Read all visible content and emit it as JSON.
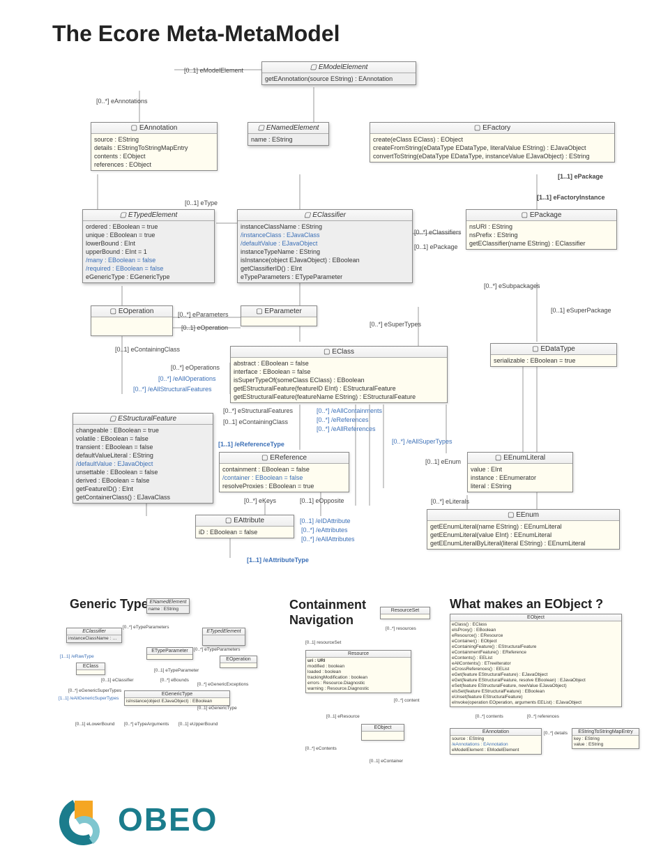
{
  "title": "The Ecore Meta-MetaModel",
  "sections": {
    "generic": "Generic Types",
    "containment": "Containment Navigation",
    "eobject": "What makes an EObject ?"
  },
  "classes": {
    "EModelElement": {
      "abstract": true,
      "ops": [
        "getEAnnotation(source EString) : EAnnotation"
      ]
    },
    "EAnnotation": {
      "attrs": [
        "source : EString",
        "details : EStringToStringMapEntry",
        "contents : EObject",
        "references : EObject"
      ]
    },
    "ENamedElement": {
      "abstract": true,
      "attrs": [
        "name : EString"
      ]
    },
    "EFactory": {
      "ops": [
        "create(eClass EClass) : EObject",
        "createFromString(eDataType EDataType, literalValue EString) : EJavaObject",
        "convertToString(eDataType EDataType, instanceValue EJavaObject) : EString"
      ]
    },
    "ETypedElement": {
      "abstract": true,
      "attrs": [
        "ordered : EBoolean = true",
        "unique : EBoolean = true",
        "lowerBound : EInt",
        "upperBound : EInt = 1"
      ],
      "derived": [
        "/many : EBoolean = false",
        "/required : EBoolean = false"
      ],
      "tail": [
        "eGenericType : EGenericType"
      ]
    },
    "EClassifier": {
      "abstract": true,
      "attrs": [
        "instanceClassName : EString"
      ],
      "derived": [
        "/instanceClass : EJavaClass",
        "/defaultValue : EJavaObject"
      ],
      "mid": [
        "instanceTypeName : EString"
      ],
      "ops": [
        "isInstance(object EJavaObject) : EBoolean",
        "getClassifierID() : EInt"
      ],
      "tail": [
        "eTypeParameters : ETypeParameter"
      ]
    },
    "EPackage": {
      "attrs": [
        "nsURI : EString",
        "nsPrefix : EString"
      ],
      "ops": [
        "getEClassifier(name EString) : EClassifier"
      ]
    },
    "EOperation": {},
    "EParameter": {},
    "EClass": {
      "attrs": [
        "abstract : EBoolean = false",
        "interface : EBoolean = false"
      ],
      "ops": [
        "isSuperTypeOf(someClass EClass) : EBoolean",
        "getEStructuralFeature(featureID EInt) : EStructuralFeature",
        "getEStructuralFeature(featureName EString) : EStructuralFeature"
      ]
    },
    "EDataType": {
      "attrs": [
        "serializable : EBoolean = true"
      ]
    },
    "EStructuralFeature": {
      "abstract": true,
      "attrs": [
        "changeable : EBoolean = true",
        "volatile : EBoolean = false",
        "transient : EBoolean = false",
        "defaultValueLiteral : EString"
      ],
      "derived": [
        "/defaultValue : EJavaObject"
      ],
      "mid": [
        "unsettable : EBoolean = false",
        "derived : EBoolean = false"
      ],
      "ops": [
        "getFeatureID() : EInt",
        "getContainerClass() : EJavaClass"
      ]
    },
    "EReference": {
      "attrs": [
        "containment : EBoolean = false"
      ],
      "derived": [
        "/container : EBoolean = false"
      ],
      "mid": [
        "resolveProxies : EBoolean = true"
      ]
    },
    "EAttribute": {
      "attrs": [
        "iD : EBoolean = false"
      ]
    },
    "EEnumLiteral": {
      "attrs": [
        "value : EInt",
        "instance : EEnumerator",
        "literal : EString"
      ]
    },
    "EEnum": {
      "ops": [
        "getEEnumLiteral(name EString) : EEnumLiteral",
        "getEEnumLiteral(value EInt) : EEnumLiteral",
        "getEEnumLiteralByLiteral(literal EString) : EEnumLiteral"
      ]
    }
  },
  "assocs": {
    "eModelElement": "[0..1] eModelElement",
    "eAnnotations": "[0..*] eAnnotations",
    "eType": "[0..1] eType",
    "ePackage11": "[1..1] ePackage",
    "eFactoryInstance": "[1..1] eFactoryInstance",
    "eClassifiers": "[0..*] eClassifiers",
    "ePackage01": "[0..1] ePackage",
    "eSubpackages": "[0..*] eSubpackages",
    "eSuperPackage": "[0..1] eSuperPackage",
    "eParameters": "[0..*] eParameters",
    "eOperation": "[0..1] eOperation",
    "eContainingClass": "[0..1] eContainingClass",
    "eOperations": "[0..*] eOperations",
    "eAllOperations": "[0..*] /eAllOperations",
    "eAllStructuralFeatures": "[0..*] /eAllStructuralFeatures",
    "eStructuralFeatures": "[0..*] eStructuralFeatures",
    "eContainingClass2": "[0..1] eContainingClass",
    "eReferenceType": "[1..1] /eReferenceType",
    "eAllContainments": "[0..*] /eAllContainments",
    "eReferences": "[0..*] /eReferences",
    "eAllReferences": "[0..*] /eAllReferences",
    "eAllSuperTypes": "[0..*] /eAllSuperTypes",
    "eSuperTypes": "[0..*] eSuperTypes",
    "eKeys": "[0..*] eKeys",
    "eOpposite": "[0..1] eOpposite",
    "eIDAttribute": "[0..1] /eIDAttribute",
    "eAttributes": "[0..*] /eAttributes",
    "eAllAttributes": "[0..*] /eAllAttributes",
    "eAttributeType": "[1..1] /eAttributeType",
    "eEnum": "[0..1] eEnum",
    "eLiterals": "[0..*] eLiterals"
  },
  "generic": {
    "ENamedElement": {
      "abstract": true,
      "attrs": [
        "name : EString"
      ]
    },
    "EClassifier": {
      "abstract": true,
      "attrs": [
        "instanceClassName : EString"
      ]
    },
    "ETypedElement": {
      "abstract": true
    },
    "EClass": {},
    "ETypeParameter": {},
    "EOperation": {},
    "EGenericType": {
      "ops": [
        "isInstance(object EJavaObject) : EBoolean"
      ]
    },
    "assocs": {
      "eTypeParameters1": "[0..*] eTypeParameters",
      "eRawType": "[1..1] /eRawType",
      "eTypeParameters2": "[0..*] eTypeParameters",
      "eTypeParameter": "[0..1] eTypeParameter",
      "eClassifier": "[0..1] eClassifier",
      "eBounds": "[0..*] eBounds",
      "eGenericExceptions": "[0..*] eGenericExceptions",
      "eGenericSuperTypes": "[0..*] eGenericSuperTypes",
      "eAllGenericSuperTypes": "[1..1] /eAllGenericSuperTypes",
      "eGenericType": "[0..1] eGenericType",
      "eLowerBound": "[0..1] eLowerBound",
      "eTypeArguments": "[0..*] eTypeArguments",
      "eUpperBound": "[0..1] eUpperBound"
    }
  },
  "containment": {
    "ResourceSet": {},
    "Resource": {
      "attrs": [
        "uri : URI",
        "modified : boolean",
        "loaded : boolean",
        "trackingModification : boolean",
        "errors : Resource.Diagnostic",
        "warning : Resource.Diagnostic"
      ]
    },
    "EObject": {},
    "assocs": {
      "resources": "[0..*] resources",
      "resourceSet": "[0..1] resourceSet",
      "content": "[0..*] content",
      "eResource": "[0..1] eResource",
      "eContents": "[0..*] eContents",
      "eContainer": "[0..1] eContainer"
    }
  },
  "eobject": {
    "EObject": {
      "ops": [
        "eClass() : EClass",
        "eIsProxy() : EBoolean",
        "eResource() : EResource",
        "eContainer() : EObject",
        "eContainingFeature() : EStructuralFeature",
        "eContainmentFeature() : EReference",
        "eContents() : EEList",
        "eAllContents() : ETreeIterator",
        "eCrossReferences() : EEList",
        "eGet(feature EStructuralFeature) : EJavaObject",
        "eGet(feature EStructuralFeature, resolve EBoolean) : EJavaObject",
        "eSet(feature EStructuralFeature, newValue EJavaObject)",
        "eIsSet(feature EStructuralFeature) : EBoolean",
        "eUnset(feature EStructuralFeature)",
        "eInvoke(operation EOperation, arguments EEList) : EJavaObject"
      ]
    },
    "EAnnotation": {
      "attrs": [
        "source : EString"
      ],
      "derived": [
        "/eAnnotations : EAnnotation"
      ],
      "tail": [
        "eModelElement : EModelElement"
      ]
    },
    "EStringToStringMapEntry": {
      "attrs": [
        "key : EString",
        "value : EString"
      ]
    },
    "assocs": {
      "contents": "[0..*] contents",
      "references": "[0..*] references",
      "details": "[0..*] details"
    }
  },
  "logo": "OBEO"
}
